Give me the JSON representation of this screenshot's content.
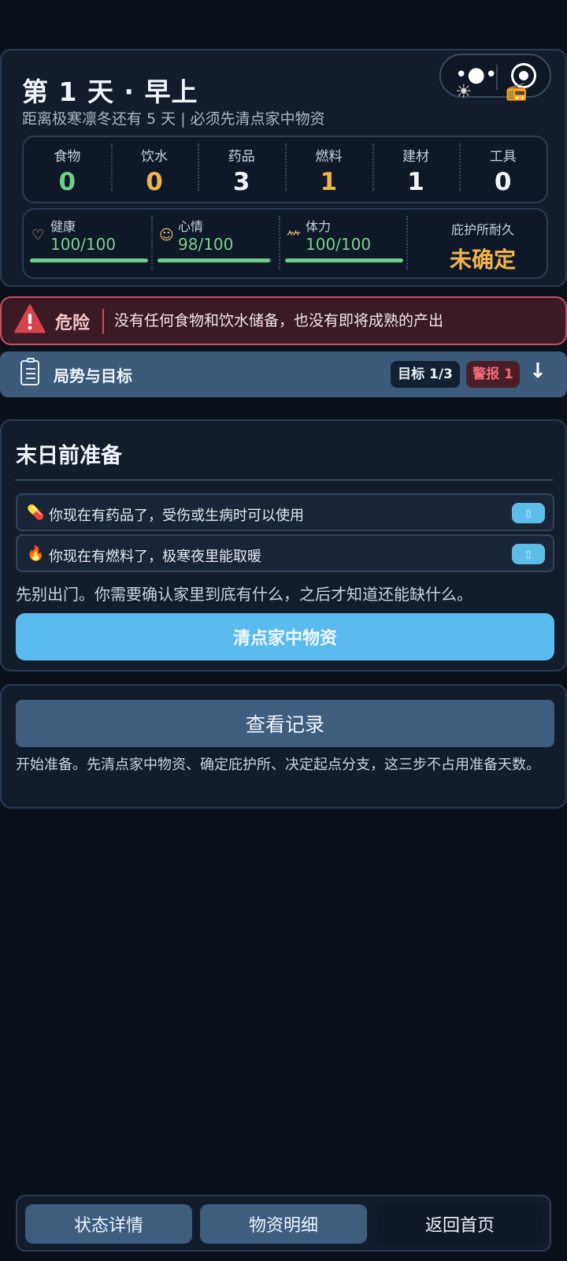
{
  "header": {
    "title": "第 1 天 · 早上",
    "subtitle": "距离极寒凛冬还有 5 天 | 必须先清点家中物资",
    "menu_icon": "more-dots-icon",
    "target_icon": "target-icon"
  },
  "resources": [
    {
      "label": "食物",
      "value": "0",
      "color": "#6dd08a"
    },
    {
      "label": "饮水",
      "value": "0",
      "color": "#f0b44c"
    },
    {
      "label": "药品",
      "value": "3",
      "color": "#f1f5fa"
    },
    {
      "label": "燃料",
      "value": "1",
      "color": "#f0b44c"
    },
    {
      "label": "建材",
      "value": "1",
      "color": "#f1f5fa"
    },
    {
      "label": "工具",
      "value": "0",
      "color": "#f1f5fa"
    }
  ],
  "stats": [
    {
      "label": "健康",
      "value": "100/100",
      "icon": "heart-icon",
      "level": 1.0
    },
    {
      "label": "心情",
      "value": "98/100",
      "icon": "smile-icon",
      "level": 0.98
    },
    {
      "label": "体力",
      "value": "100/100",
      "icon": "stamina-icon",
      "level": 1.0
    }
  ],
  "shelter": {
    "label": "庇护所耐久",
    "value": "未确定"
  },
  "danger": {
    "tag": "危险",
    "message": "没有任何食物和饮水储备，也没有即将成熟的产出"
  },
  "situation": {
    "title": "局势与目标",
    "goal_badge": "目标 1/3",
    "alert_badge": "警报 1"
  },
  "prep": {
    "title": "末日前准备",
    "tips": [
      {
        "emoji": "💊",
        "text": "你现在有药品了，受伤或生病时可以使用"
      },
      {
        "emoji": "🔥",
        "text": "你现在有燃料了，极寒夜里能取暖"
      }
    ],
    "description": "先别出门。你需要确认家里到底有什么，之后才知道还能缺什么。",
    "action_label": "清点家中物资"
  },
  "log": {
    "button_label": "查看记录",
    "note": "开始准备。先清点家中物资、确定庇护所、决定起点分支，这三步不占用准备天数。"
  },
  "bottom_nav": {
    "status_label": "状态详情",
    "supplies_label": "物资明细",
    "home_label": "返回首页"
  }
}
